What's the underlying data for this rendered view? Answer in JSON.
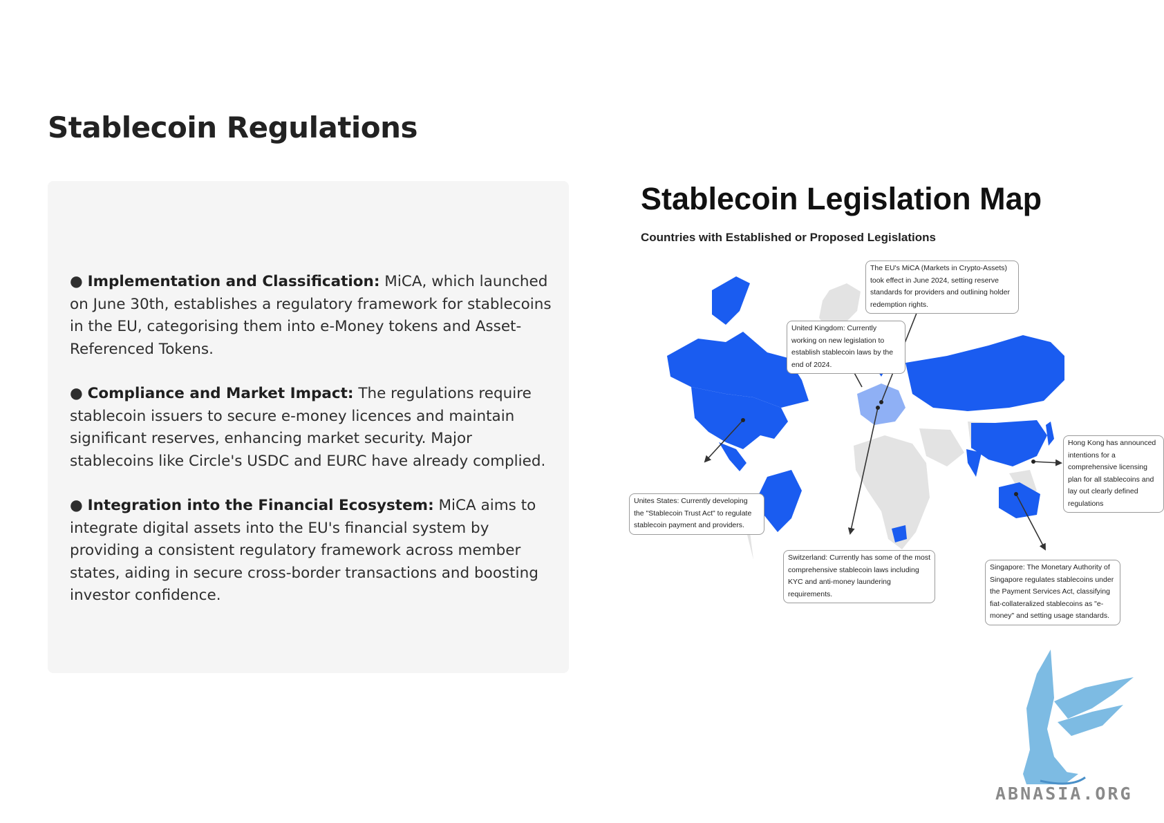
{
  "page": {
    "title": "Stablecoin Regulations"
  },
  "bullets": [
    {
      "marker": "●",
      "heading": "Implementation and Classification:",
      "text": " MiCA, which launched on June 30th, establishes a regulatory framework for stablecoins in the EU, categorising them into e-Money tokens and Asset-Referenced Tokens."
    },
    {
      "marker": "●",
      "heading": "Compliance and Market Impact:",
      "text": " The regulations require stablecoin issuers to secure e-money licences and maintain significant reserves, enhancing market security. Major stablecoins like Circle's USDC and EURC have already complied."
    },
    {
      "marker": "●",
      "heading": "Integration into the Financial Ecosystem:",
      "text": " MiCA aims to integrate digital assets into the EU's financial system by providing a consistent regulatory framework across member states, aiding in secure cross-border transactions and boosting investor confidence."
    }
  ],
  "map": {
    "title": "Stablecoin Legislation Map",
    "subtitle": "Countries with Established or Proposed Legislations",
    "colors": {
      "legislated": "#1a5cf0",
      "eu_light": "#8fb0f5",
      "other": "#e3e3e3",
      "arrow": "#333333"
    },
    "callouts": {
      "eu": "The EU's MiCA (Markets in Crypto-Assets) took effect in June 2024, setting reserve standards for providers and outlining holder redemption rights.",
      "uk": "United Kingdom: Currently working on new legislation to establish stablecoin laws by the end of 2024.",
      "us": "Unites States: Currently developing the \"Stablecoin Trust Act\" to regulate stablecoin payment and providers.",
      "switzerland": "Switzerland: Currently has some of the most comprehensive stablecoin laws including  KYC and anti-money laundering requirements.",
      "hongkong": "Hong Kong has announced intentions for a comprehensive licensing plan for all stablecoins and lay out clearly defined regulations",
      "singapore": "Singapore: The Monetary Authority of Singapore regulates stablecoins under the Payment Services Act, classifying fiat-collateralized stablecoins as \"e-money\" and setting usage standards."
    }
  },
  "logo": {
    "icon": "griffin-logo-icon",
    "text": "ABNASIA.ORG",
    "color": "#6fb4e0"
  }
}
